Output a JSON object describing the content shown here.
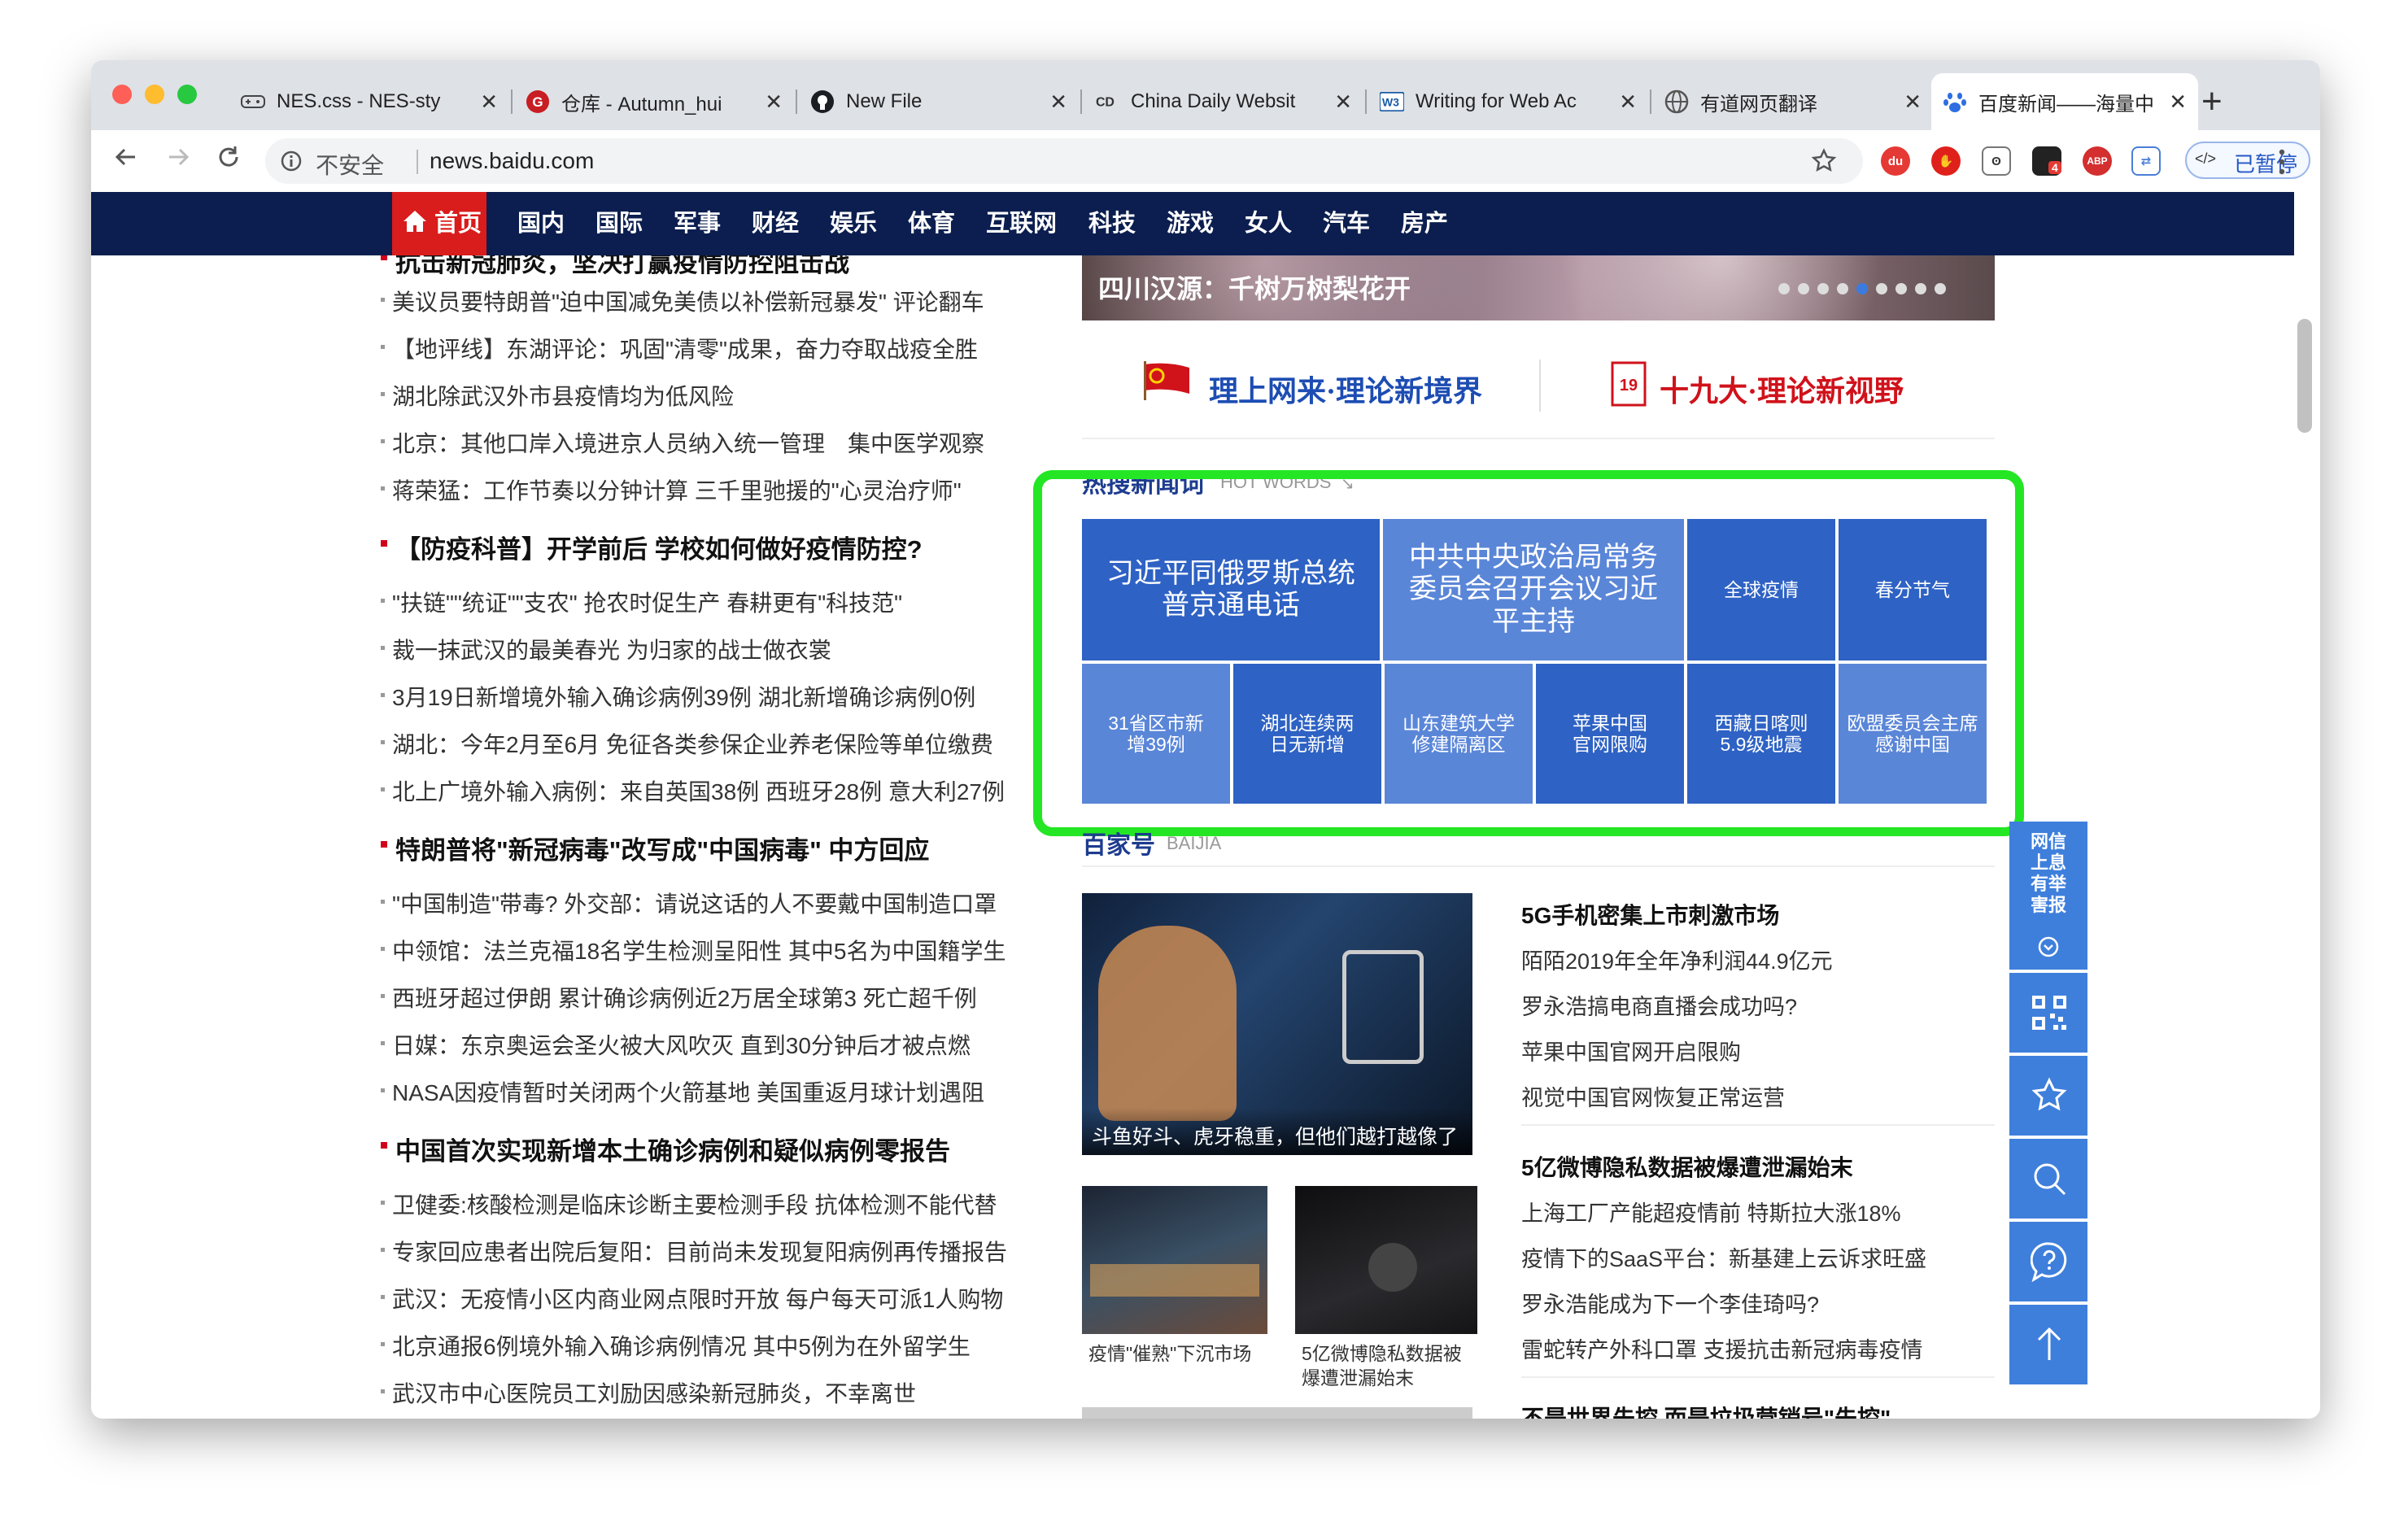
{
  "browser": {
    "tabs": [
      {
        "title": "NES.css - NES-sty",
        "favicon": "controller-icon"
      },
      {
        "title": "仓库 - Autumn_hui",
        "favicon": "gitee-icon"
      },
      {
        "title": "New File",
        "favicon": "github-icon"
      },
      {
        "title": "China Daily Websit",
        "favicon": "chinadaily-icon"
      },
      {
        "title": "Writing for Web Ac",
        "favicon": "w3c-icon"
      },
      {
        "title": "有道网页翻译",
        "favicon": "globe-icon"
      },
      {
        "title": "百度新闻——海量中",
        "favicon": "baidu-paw-icon"
      }
    ],
    "close_glyph": "✕",
    "new_tab": "+",
    "security": "不安全",
    "url": "news.baidu.com",
    "extensions": [
      "du",
      "4",
      "ABP"
    ],
    "paused_label": "已暂停",
    "code_icon_text": "</>"
  },
  "nav": {
    "items": [
      "首页",
      "国内",
      "国际",
      "军事",
      "财经",
      "娱乐",
      "体育",
      "互联网",
      "科技",
      "游戏",
      "女人",
      "汽车",
      "房产"
    ]
  },
  "left": {
    "cut_title": "抗击新冠肺炎，坚决打赢疫情防控阻击战",
    "group1": [
      "美议员要特朗普\"迫中国减免美债以补偿新冠暴发\" 评论翻车",
      "【地评线】东湖评论：巩固\"清零\"成果，奋力夺取战疫全胜",
      "湖北除武汉外市县疫情均为低风险",
      "北京：其他口岸入境进京人员纳入统一管理　集中医学观察",
      "蒋荣猛：工作节奏以分钟计算 三千里驰援的\"心灵治疗师\""
    ],
    "head2": "【防疫科普】开学前后 学校如何做好疫情防控?",
    "group2": [
      "\"扶链\"\"统证\"\"支农\" 抢农时促生产 春耕更有\"科技范\"",
      "裁一抹武汉的最美春光 为归家的战士做衣裳",
      "3月19日新增境外输入确诊病例39例 湖北新增确诊病例0例",
      "湖北：今年2月至6月 免征各类参保企业养老保险等单位缴费",
      "北上广境外输入病例：来自英国38例 西班牙28例 意大利27例"
    ],
    "head3": "特朗普将\"新冠病毒\"改写成\"中国病毒\" 中方回应",
    "group3": [
      "\"中国制造\"带毒? 外交部：请说这话的人不要戴中国制造口罩",
      "中领馆：法兰克福18名学生检测呈阳性 其中5名为中国籍学生",
      "西班牙超过伊朗 累计确诊病例近2万居全球第3 死亡超千例",
      "日媒：东京奥运会圣火被大风吹灭 直到30分钟后才被点燃",
      "NASA因疫情暂时关闭两个火箭基地 美国重返月球计划遇阻"
    ],
    "head4": "中国首次实现新增本土确诊病例和疑似病例零报告",
    "group4": [
      "卫健委:核酸检测是临床诊断主要检测手段 抗体检测不能代替",
      "专家回应患者出院后复阳：目前尚未发现复阳病例再传播报告",
      "武汉：无疫情小区内商业网点限时开放 每户每天可派1人购物",
      "北京通报6例境外输入确诊病例情况 其中5例为在外留学生",
      "武汉市中心医院员工刘励因感染新冠肺炎，不幸离世"
    ]
  },
  "slider": {
    "caption": "四川汉源：千树万树梨花开"
  },
  "banners": {
    "left": "理上网来·理论新境界",
    "right": "十九大·理论新视野"
  },
  "hotwords": {
    "title": "热搜新闻词",
    "subtitle": "HOT WORDS",
    "top": [
      "习近平同俄罗斯总统普京通电话",
      "中共中央政治局常务委员会召开会议习近平主持",
      "全球疫情",
      "春分节气"
    ],
    "bottom": [
      "31省区市新增39例",
      "湖北连续两日无新增",
      "山东建筑大学修建隔离区",
      "苹果中国官网限购",
      "西藏日喀则5.9级地震",
      "欧盟委员会主席感谢中国"
    ]
  },
  "baijia": {
    "title": "百家号",
    "subtitle": "BAIJIA",
    "big_caption": "斗鱼好斗、虎牙稳重，但他们越打越像了",
    "small_caption1": "疫情\"催熟\"下沉市场",
    "small_caption2": "5亿微博隐私数据被爆遭泄漏始末",
    "group1_head": "5G手机密集上市刺激市场",
    "group1": [
      "陌陌2019年全年净利润44.9亿元",
      "罗永浩搞电商直播会成功吗?",
      "苹果中国官网开启限购",
      "视觉中国官网恢复正常运营"
    ],
    "group2_head": "5亿微博隐私数据被爆遭泄漏始末",
    "group2": [
      "上海工厂产能超疫情前 特斯拉大涨18%",
      "疫情下的SaaS平台：新基建上云诉求旺盛",
      "罗永浩能成为下一个李佳琦吗?",
      "雷蛇转产外科口罩 支援抗击新冠病毒疫情"
    ],
    "group3_head": "不是世界先控 而是垃圾营销号\"先控\""
  },
  "sidebar": {
    "report_label": "网信上息有举害报"
  },
  "colors": {
    "nav_bg": "#0b1e4f",
    "nav_home": "#d91c1c",
    "hot_dark": "#2e62c4",
    "hot_light": "#5a86d8",
    "highlight": "#24e624",
    "side_blue": "#3e7fdc"
  }
}
